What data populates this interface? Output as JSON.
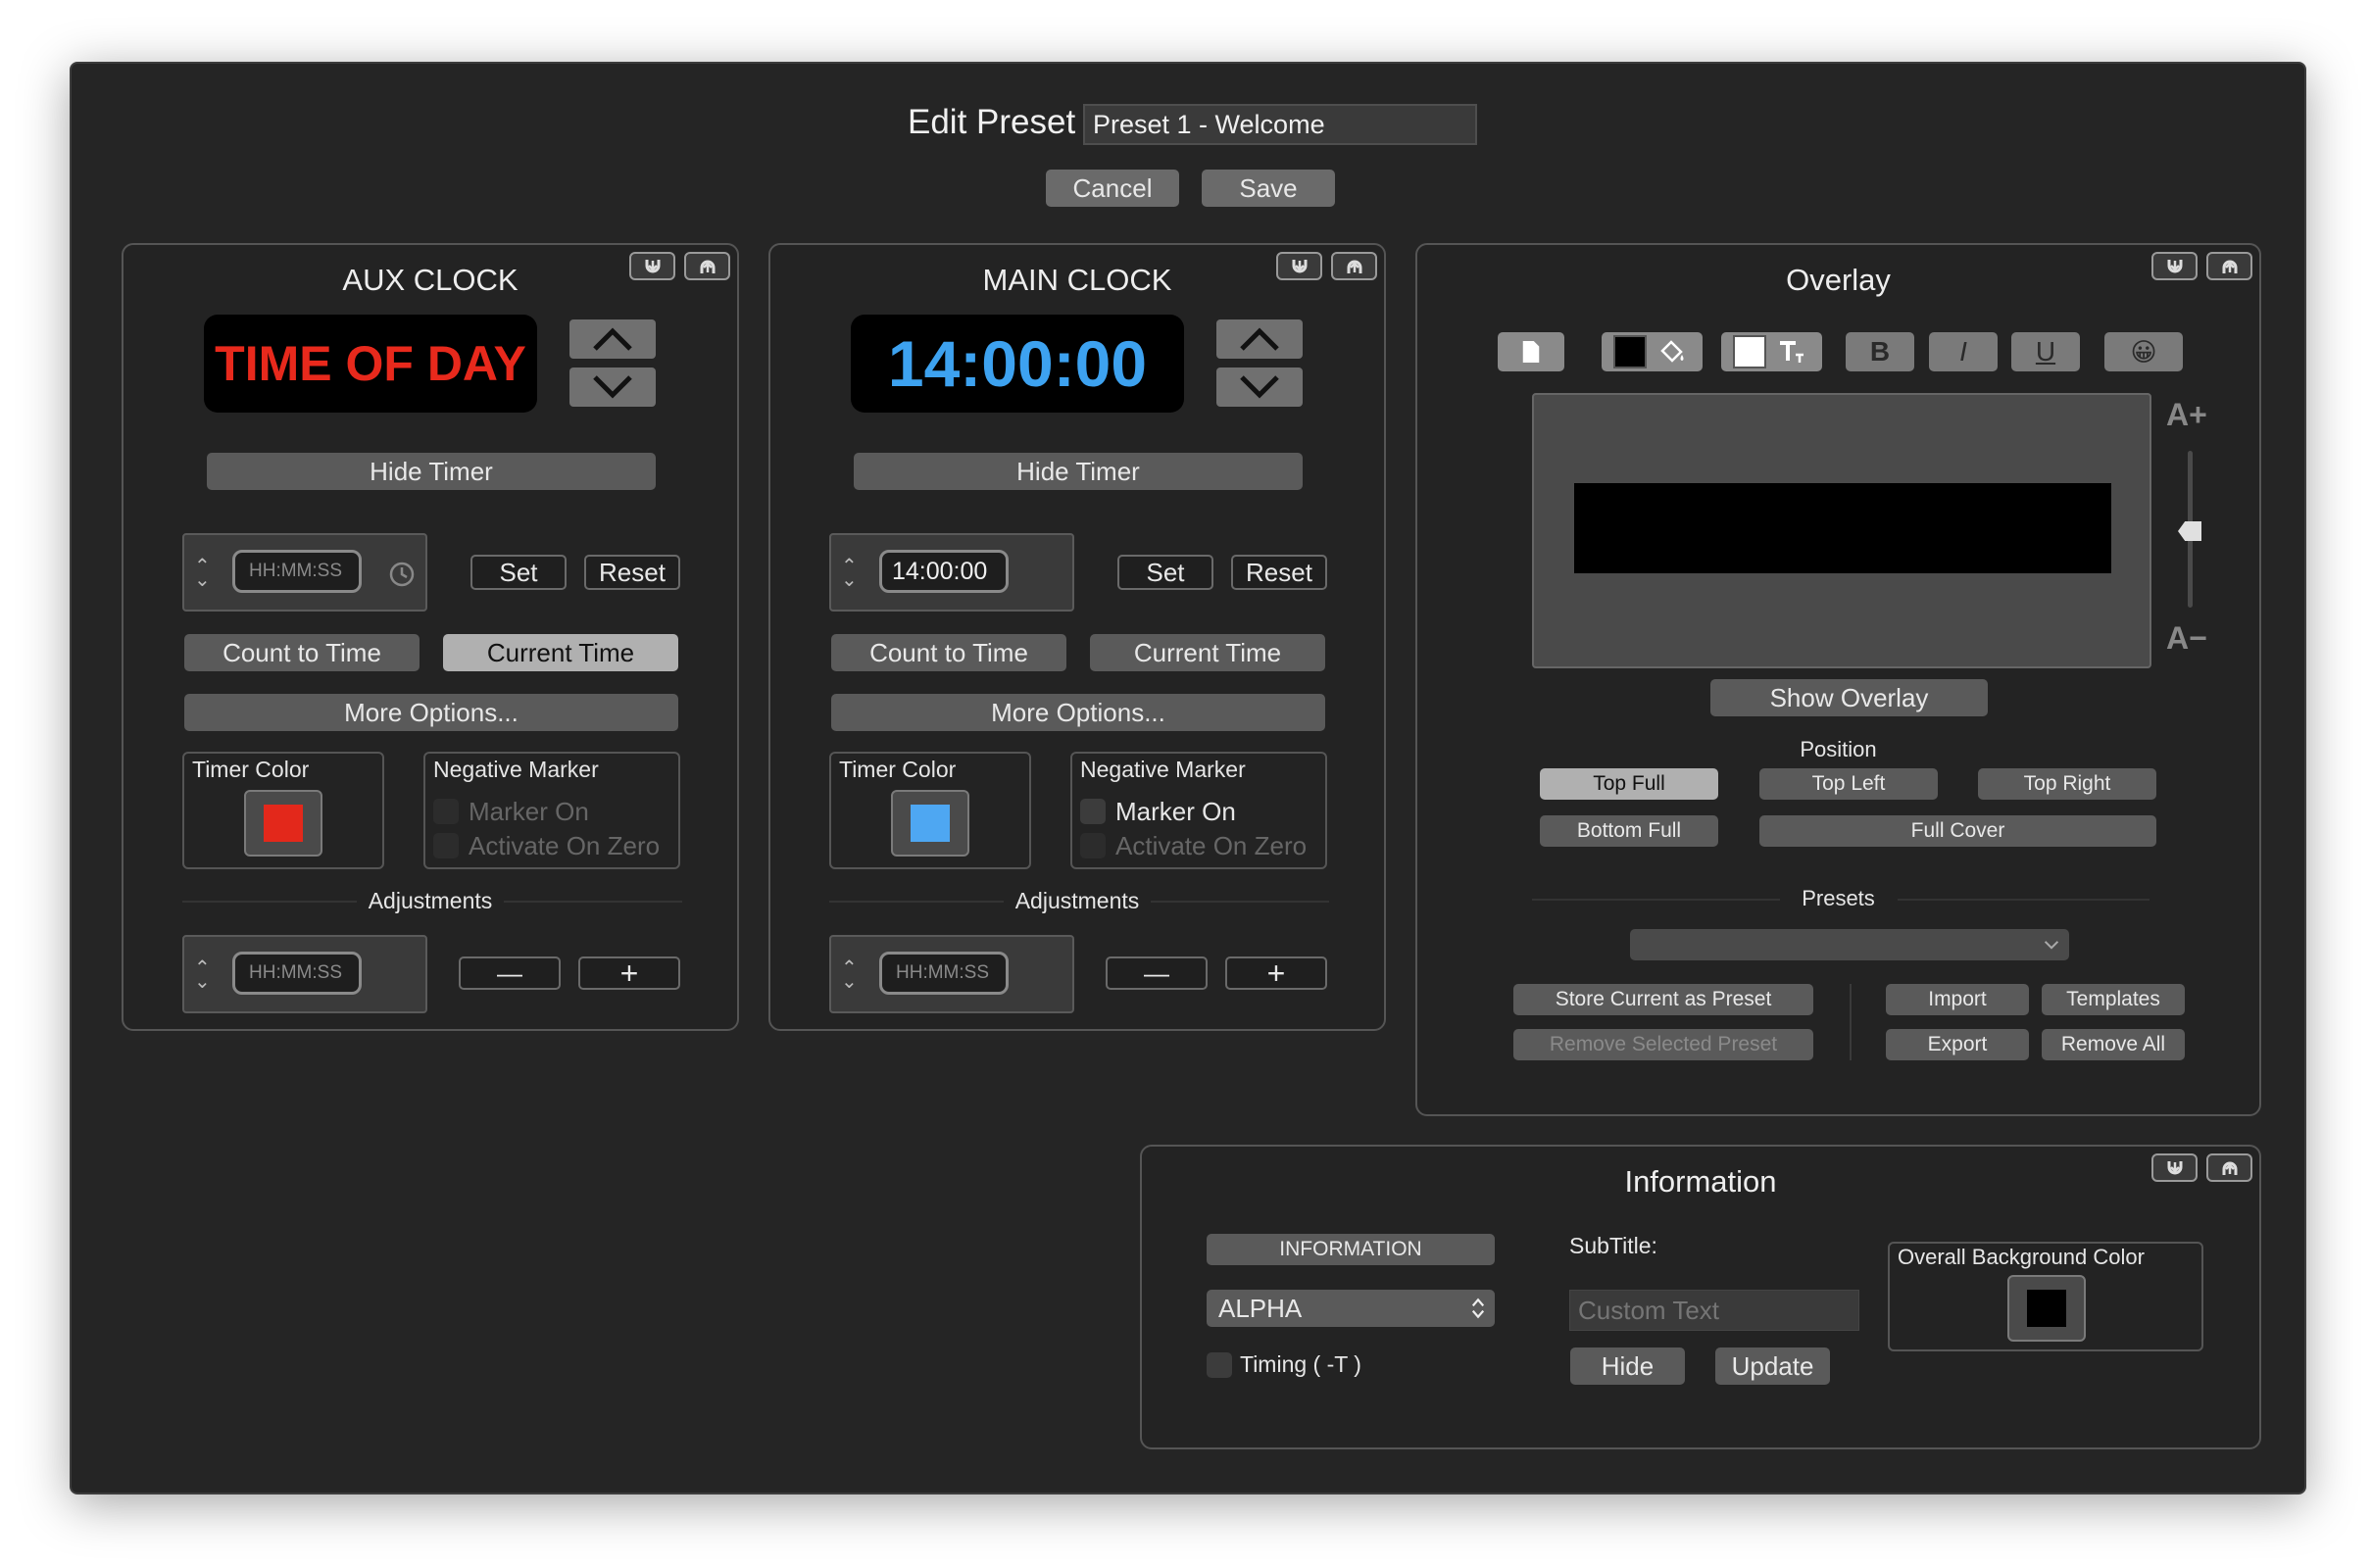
{
  "header": {
    "title": "Edit Preset",
    "preset_name": "Preset 1 - Welcome",
    "cancel_label": "Cancel",
    "save_label": "Save"
  },
  "aux": {
    "title": "AUX CLOCK",
    "display_text": "TIME OF DAY",
    "display_color": "#e8291c",
    "hide_timer": "Hide Timer",
    "time_placeholder": "HH:MM:SS",
    "set": "Set",
    "reset": "Reset",
    "count_to_time": "Count to Time",
    "current_time": "Current Time",
    "more_options": "More Options...",
    "timer_color_label": "Timer Color",
    "timer_color": "#e3281b",
    "negative_marker": "Negative Marker",
    "marker_on": "Marker On",
    "activate_on_zero": "Activate On Zero",
    "adjustments": "Adjustments",
    "adj_placeholder": "HH:MM:SS",
    "minus": "—",
    "plus": "+"
  },
  "main": {
    "title": "MAIN CLOCK",
    "display_text": "14:00:00",
    "display_color": "#3da2f0",
    "hide_timer": "Hide Timer",
    "time_value": "14:00:00",
    "set": "Set",
    "reset": "Reset",
    "count_to_time": "Count to Time",
    "current_time": "Current Time",
    "more_options": "More Options...",
    "timer_color_label": "Timer Color",
    "timer_color": "#4ea7f2",
    "negative_marker": "Negative Marker",
    "marker_on": "Marker On",
    "activate_on_zero": "Activate On Zero",
    "adjustments": "Adjustments",
    "adj_placeholder": "HH:MM:SS",
    "minus": "—",
    "plus": "+"
  },
  "overlay": {
    "title": "Overlay",
    "bold": "B",
    "italic": "I",
    "underline": "U",
    "emoji": "😀",
    "font_up": "A+",
    "font_down": "A−",
    "show_overlay": "Show Overlay",
    "position_label": "Position",
    "top_full": "Top Full",
    "top_left": "Top Left",
    "top_right": "Top Right",
    "bottom_full": "Bottom Full",
    "full_cover": "Full Cover",
    "presets_label": "Presets",
    "store_preset": "Store Current as Preset",
    "remove_preset": "Remove Selected Preset",
    "import": "Import",
    "templates": "Templates",
    "export": "Export",
    "remove_all": "Remove All"
  },
  "information": {
    "title": "Information",
    "info_button": "INFORMATION",
    "select_value": "ALPHA",
    "timing_label": "Timing ( -T )",
    "subtitle_label": "SubTitle:",
    "subtitle_placeholder": "Custom Text",
    "hide": "Hide",
    "update": "Update",
    "bg_color_label": "Overall Background Color",
    "bg_color": "#000000"
  }
}
